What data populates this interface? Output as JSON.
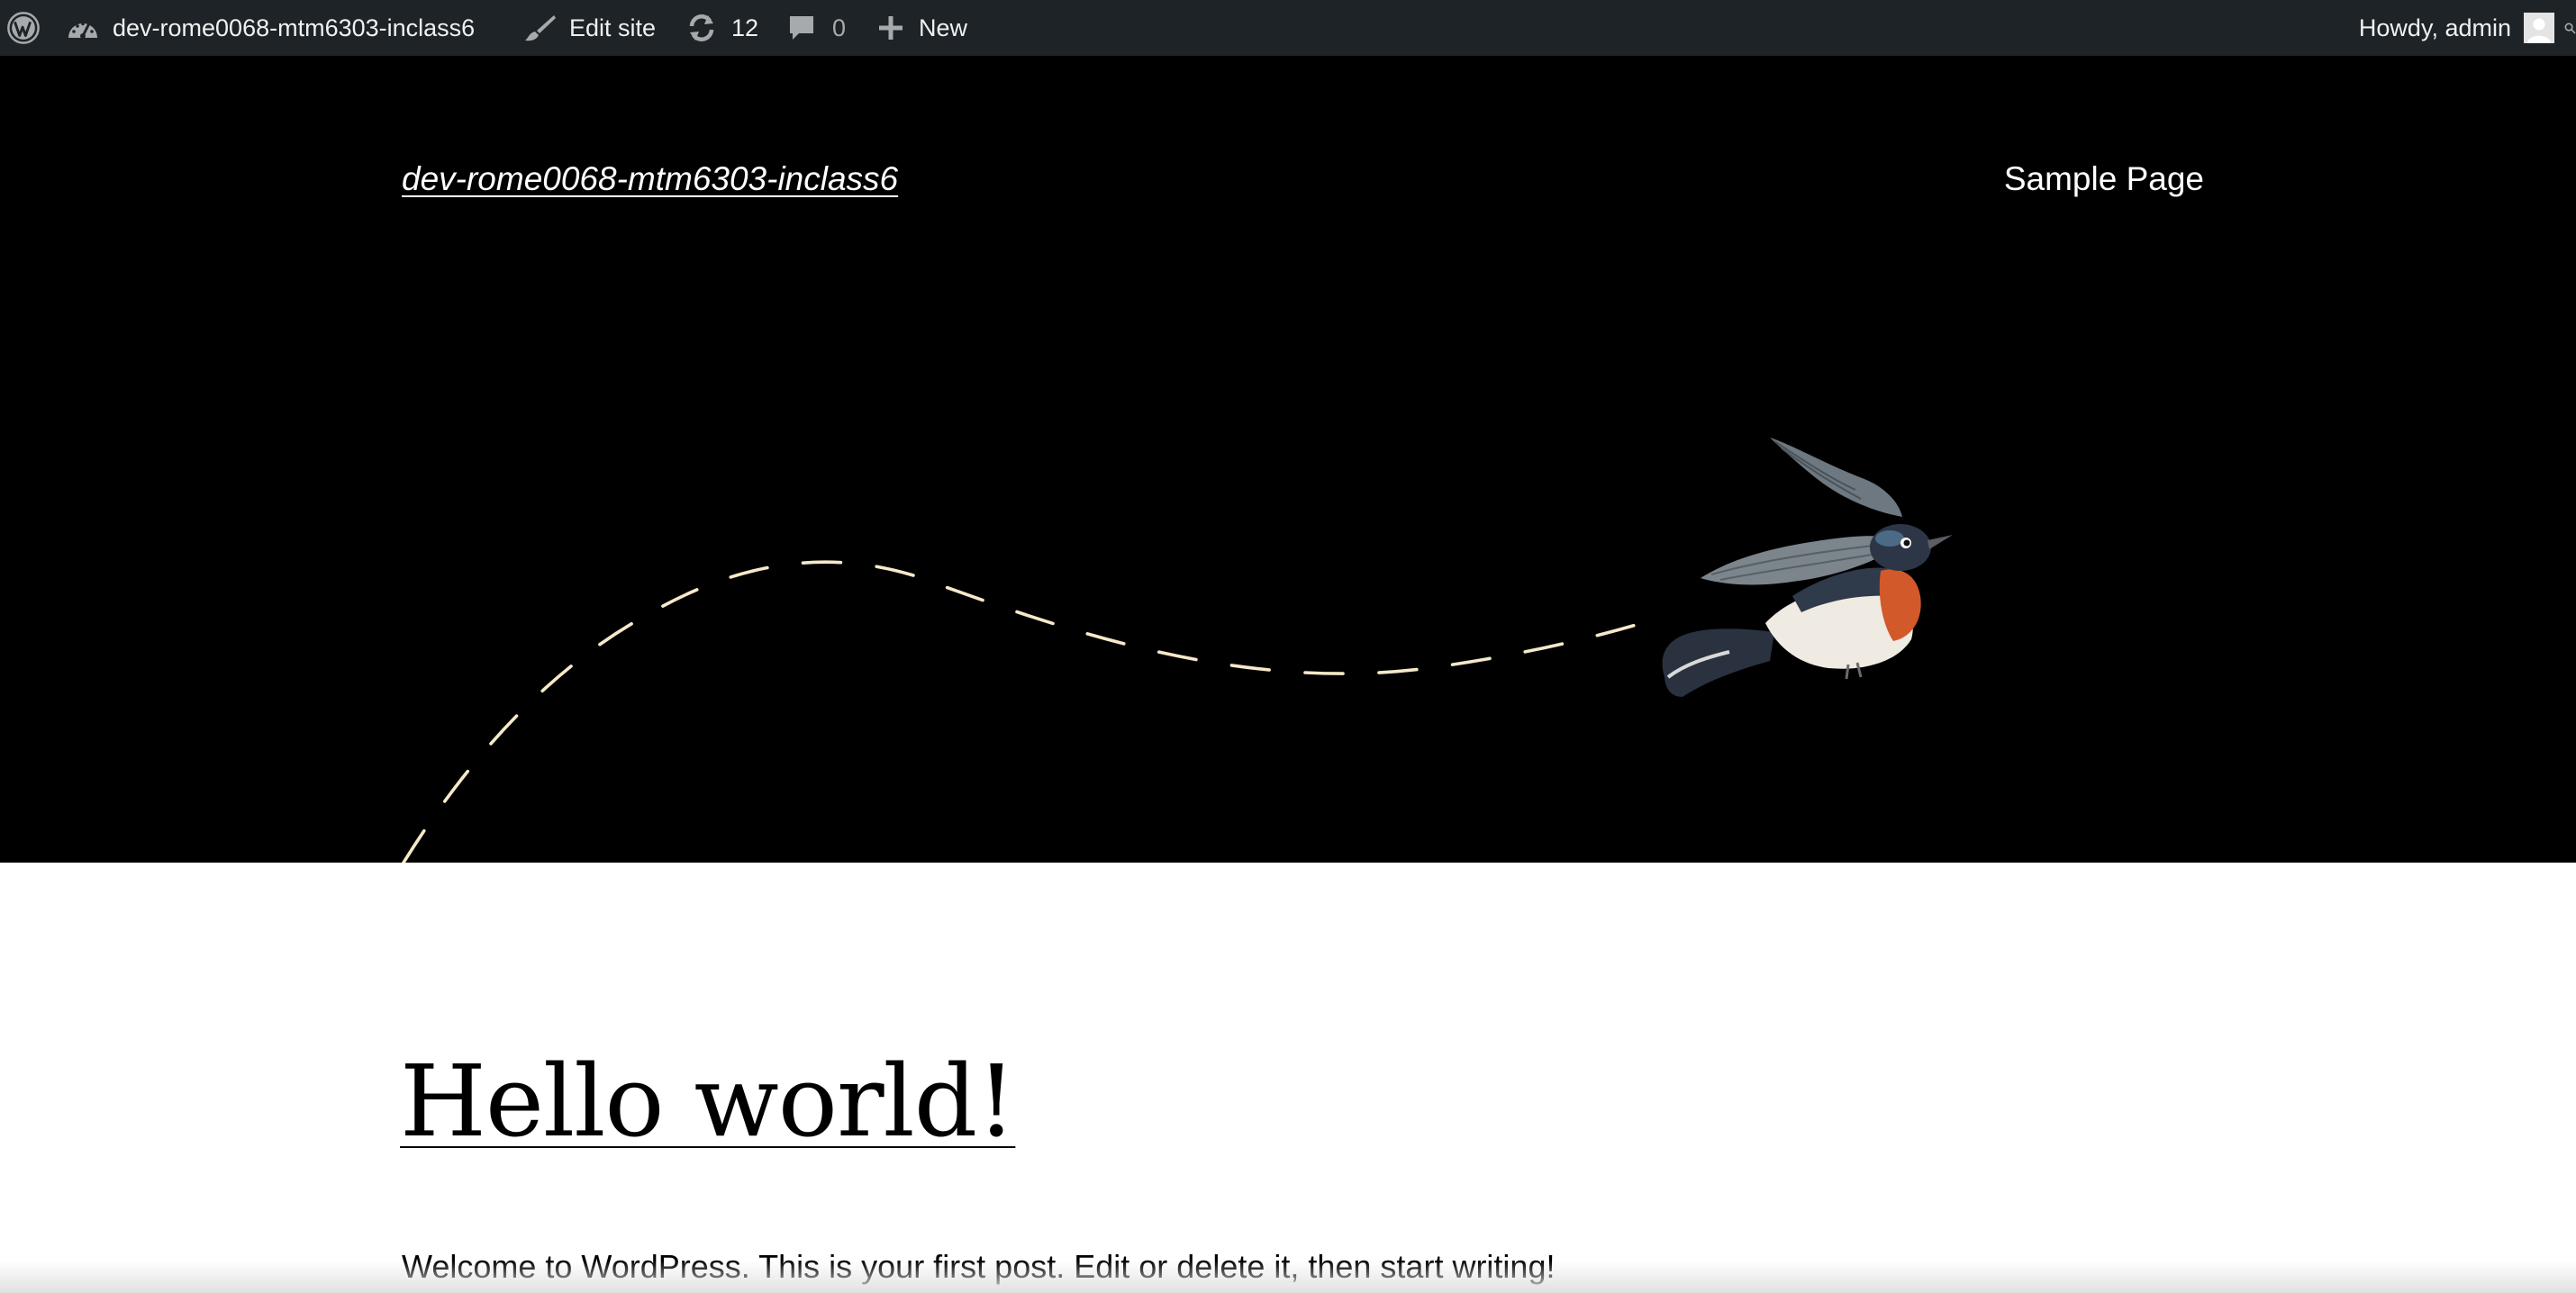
{
  "adminbar": {
    "site_name": "dev-rome0068-mtm6303-inclass6",
    "edit_site": "Edit site",
    "updates_count": "12",
    "comments_count": "0",
    "new_label": "New",
    "greeting": "Howdy, admin",
    "icons": {
      "wordpress": "wordpress-logo-icon",
      "dashboard": "dashboard-gauge-icon",
      "edit": "brush-icon",
      "updates": "refresh-icon",
      "comments": "comment-bubble-icon",
      "new": "plus-icon",
      "avatar": "avatar-icon",
      "search": "search-icon"
    },
    "colors": {
      "background": "#1d2327",
      "text": "#f0f0f1",
      "muted": "#a7aaad"
    }
  },
  "header": {
    "site_title": "dev-rome0068-mtm6303-inclass6",
    "nav_items": [
      "Sample Page"
    ],
    "background_color": "#000000",
    "path_color": "#f6e9c9"
  },
  "post": {
    "title": "Hello world!",
    "excerpt": "Welcome to WordPress. This is your first post. Edit or delete it, then start writing!"
  }
}
